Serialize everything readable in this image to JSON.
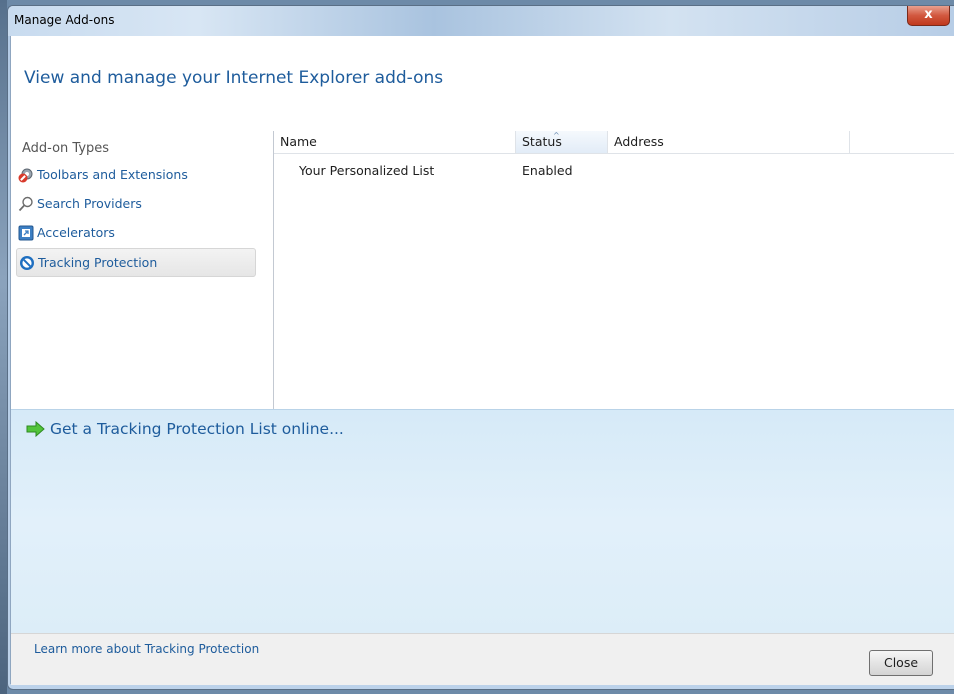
{
  "window": {
    "title": "Manage Add-ons",
    "close_glyph": "x"
  },
  "header": {
    "title": "View and manage your Internet Explorer add-ons"
  },
  "sidebar": {
    "heading": "Add-on Types",
    "items": [
      {
        "label": "Toolbars and Extensions",
        "icon": "gear-icon"
      },
      {
        "label": "Search Providers",
        "icon": "search-icon"
      },
      {
        "label": "Accelerators",
        "icon": "accelerator-icon"
      },
      {
        "label": "Tracking Protection",
        "icon": "tracking-protection-icon"
      }
    ],
    "selected": "Tracking Protection"
  },
  "list": {
    "columns": [
      "Name",
      "Status",
      "Address"
    ],
    "sorted_column": "Status",
    "rows": [
      {
        "name": "Your Personalized List",
        "status": "Enabled",
        "address": ""
      }
    ]
  },
  "details": {
    "link": "Get a Tracking Protection List online..."
  },
  "footer": {
    "learn_more": "Learn more about Tracking Protection",
    "close_label": "Close"
  },
  "colors": {
    "link": "#1e5c9c",
    "details_bg": "#dcedf8",
    "close_button_red": "#c0391d"
  }
}
